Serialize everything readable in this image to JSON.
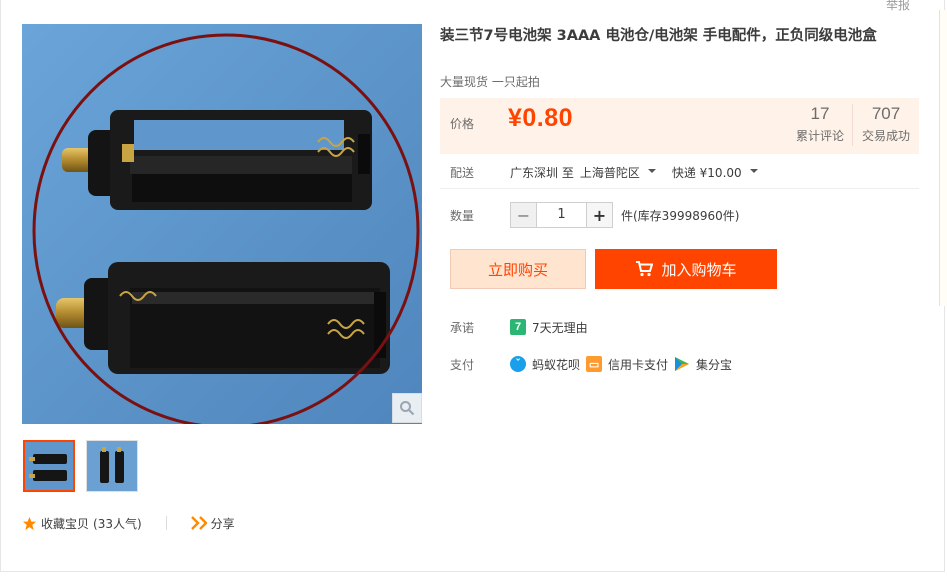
{
  "header": {
    "report_label": "举报"
  },
  "gallery": {
    "main_image": "battery-holder-photo",
    "thumbnails": [
      "battery-holder-photo",
      "battery-holder-side-photo"
    ],
    "zoom_icon": "magnifier-icon"
  },
  "product": {
    "title": "装三节7号电池架 3AAA 电池仓/电池架 手电配件，正负同级电池盒",
    "subtitle": "大量现货 一只起拍"
  },
  "price": {
    "label": "价格",
    "value": "¥0.80",
    "reviews_count": "17",
    "reviews_label": "累计评论",
    "sales_count": "707",
    "sales_label": "交易成功"
  },
  "shipping": {
    "label": "配送",
    "origin": "广东深圳 至",
    "destination": "上海普陀区",
    "method": "快递 ¥10.00"
  },
  "quantity": {
    "label": "数量",
    "value": "1",
    "minus": "−",
    "plus": "+",
    "stock": "件(库存39998960件)"
  },
  "buttons": {
    "buy_now": "立即购买",
    "add_to_cart": "加入购物车"
  },
  "promise": {
    "label": "承诺",
    "badge": "7",
    "text": "7天无理由"
  },
  "payment": {
    "label": "支付",
    "methods": [
      "蚂蚁花呗",
      "信用卡支付",
      "集分宝"
    ]
  },
  "actions": {
    "favorite": "收藏宝贝",
    "favorite_count": "(33人气)",
    "share": "分享"
  },
  "colors": {
    "accent": "#ff4400",
    "price_bg": "#fff2e8",
    "buy_bg": "#ffe4d0",
    "ring": "#7a1010",
    "photo_bg": "#5f97cc"
  }
}
